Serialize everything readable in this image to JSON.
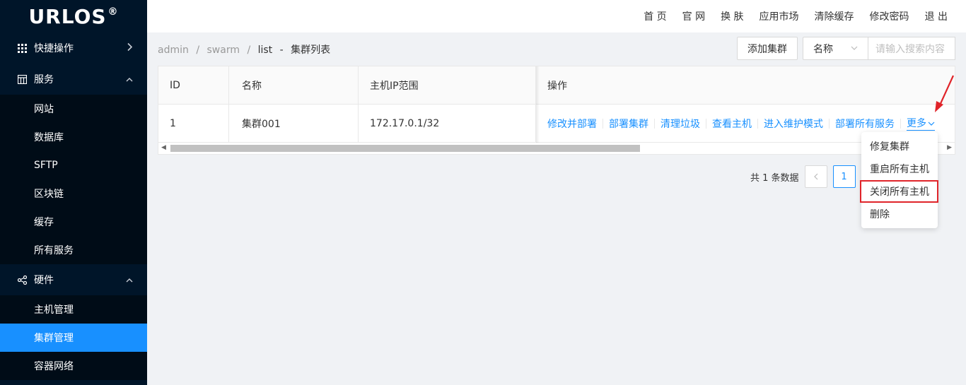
{
  "logo": {
    "text": "URLOS",
    "mark": "®"
  },
  "sidebar": {
    "groups": [
      {
        "label": "快捷操作",
        "icon": "grid-icon",
        "arrow": "›"
      },
      {
        "label": "服务",
        "icon": "window-icon",
        "arrow": "ˆ"
      },
      {
        "label": "硬件",
        "icon": "share-icon",
        "arrow": "ˆ"
      }
    ],
    "service_items": [
      "网站",
      "数据库",
      "SFTP",
      "区块链",
      "缓存",
      "所有服务"
    ],
    "hardware_items": [
      "主机管理",
      "集群管理",
      "容器网络"
    ],
    "active_item": "集群管理"
  },
  "header": {
    "links": [
      "首 页",
      "官 网",
      "换 肤",
      "应用市场",
      "清除缓存",
      "修改密码",
      "退 出"
    ]
  },
  "breadcrumb": {
    "items": [
      "admin",
      "/",
      "swarm",
      "/",
      "list",
      "-",
      "集群列表"
    ]
  },
  "toolbar": {
    "add_label": "添加集群",
    "select_value": "名称",
    "search_placeholder": "请输入搜索内容"
  },
  "table": {
    "headers": [
      "ID",
      "名称",
      "主机IP范围",
      "操作"
    ],
    "rows": [
      {
        "id": "1",
        "name": "集群001",
        "ip_range": "172.17.0.1/32"
      }
    ],
    "actions": [
      "修改并部署",
      "部署集群",
      "清理垃圾",
      "查看主机",
      "进入维护模式",
      "部署所有服务"
    ],
    "more_label": "更多"
  },
  "pagination": {
    "total_text": "共 1 条数据",
    "current_page": "1"
  },
  "dropdown": {
    "items": [
      "修复集群",
      "重启所有主机",
      "关闭所有主机",
      "删除"
    ],
    "highlighted": "关闭所有主机"
  },
  "colors": {
    "sidebar_bg": "#001529",
    "accent": "#1890ff",
    "highlight_red": "#e0242a"
  }
}
